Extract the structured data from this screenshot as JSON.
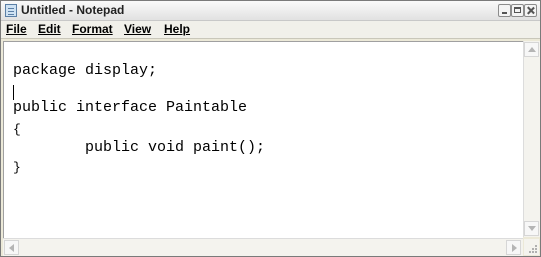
{
  "window": {
    "title": "Untitled - Notepad",
    "icon": "notepad-icon"
  },
  "controls": {
    "minimize": "minimize-icon",
    "maximize": "maximize-icon",
    "close": "close-icon"
  },
  "menu": {
    "items": [
      "File",
      "Edit",
      "Format",
      "View",
      "Help"
    ]
  },
  "editor": {
    "lines": [
      "package display;",
      "",
      "public interface Paintable",
      "{",
      "        public void paint();",
      "}"
    ]
  }
}
